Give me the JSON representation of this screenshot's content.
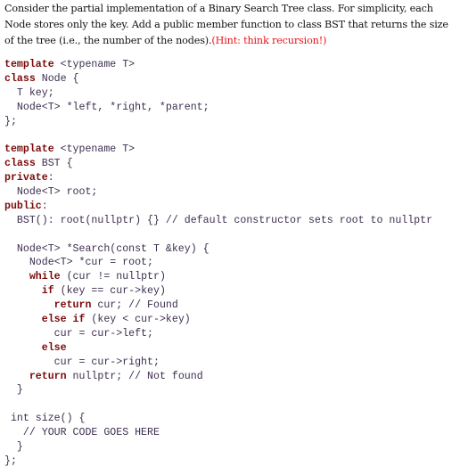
{
  "intro": {
    "text": "Consider the partial implementation of a Binary Search Tree class. For simplicity, each Node stores only the key. Add a public member function to class BST that returns the size of the tree (i.e., the number of the nodes).",
    "hint": "(Hint: think recursion!)"
  },
  "colors": {
    "keyword": "#7a0a0a",
    "code_text": "#3d2f4f",
    "hint": "#e8141a",
    "body_text": "#111111"
  },
  "code_lines": [
    [
      {
        "k": true,
        "t": "template"
      },
      {
        "t": " <typename T>"
      }
    ],
    [
      {
        "k": true,
        "t": "class"
      },
      {
        "t": " Node {"
      }
    ],
    [
      {
        "t": "  T key;"
      }
    ],
    [
      {
        "t": "  Node<T> *left, *right, *parent;"
      }
    ],
    [
      {
        "t": "};"
      }
    ],
    [],
    [
      {
        "k": true,
        "t": "template"
      },
      {
        "t": " <typename T>"
      }
    ],
    [
      {
        "k": true,
        "t": "class"
      },
      {
        "t": " BST {"
      }
    ],
    [
      {
        "k": true,
        "t": "private"
      },
      {
        "t": ":"
      }
    ],
    [
      {
        "t": "  Node<T> root;"
      }
    ],
    [
      {
        "k": true,
        "t": "public"
      },
      {
        "t": ":"
      }
    ],
    [
      {
        "t": "  BST(): root(nullptr) {} // default constructor sets root to nullptr"
      }
    ],
    [],
    [
      {
        "t": "  Node<T> *Search(const T &key) {"
      }
    ],
    [
      {
        "t": "    Node<T> *cur = root;"
      }
    ],
    [
      {
        "t": "    "
      },
      {
        "k": true,
        "t": "while"
      },
      {
        "t": " (cur != nullptr)"
      }
    ],
    [
      {
        "t": "      "
      },
      {
        "k": true,
        "t": "if"
      },
      {
        "t": " (key == cur->key)"
      }
    ],
    [
      {
        "t": "        "
      },
      {
        "k": true,
        "t": "return"
      },
      {
        "t": " cur; // Found"
      }
    ],
    [
      {
        "t": "      "
      },
      {
        "k": true,
        "t": "else if"
      },
      {
        "t": " (key < cur->key)"
      }
    ],
    [
      {
        "t": "        cur = cur->left;"
      }
    ],
    [
      {
        "t": "      "
      },
      {
        "k": true,
        "t": "else"
      }
    ],
    [
      {
        "t": "        cur = cur->right;"
      }
    ],
    [
      {
        "t": "    "
      },
      {
        "k": true,
        "t": "return"
      },
      {
        "t": " nullptr; // Not found"
      }
    ],
    [
      {
        "t": "  }"
      }
    ],
    [],
    [
      {
        "t": " int size() {"
      }
    ],
    [
      {
        "t": "   // YOUR CODE GOES HERE"
      }
    ],
    [
      {
        "t": "  }"
      }
    ],
    [
      {
        "t": "};"
      }
    ]
  ]
}
